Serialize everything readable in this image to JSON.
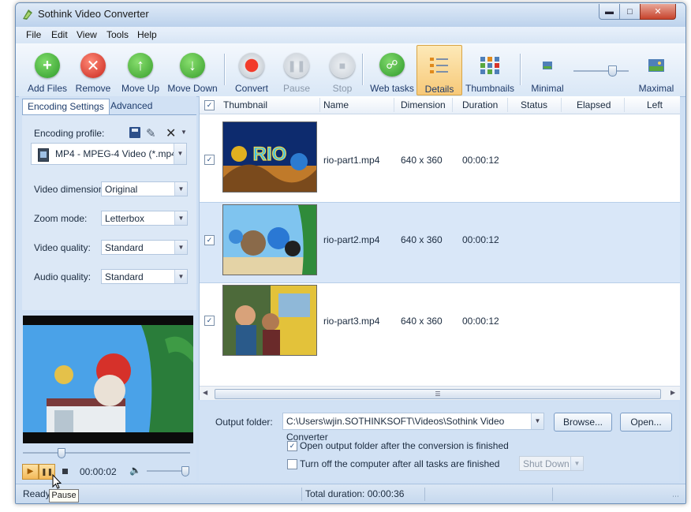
{
  "window": {
    "title": "Sothink Video Converter"
  },
  "menu": [
    "File",
    "Edit",
    "View",
    "Tools",
    "Help"
  ],
  "toolbar": {
    "add": "Add Files",
    "remove": "Remove",
    "move_up": "Move Up",
    "move_down": "Move Down",
    "convert": "Convert",
    "pause": "Pause",
    "stop": "Stop",
    "web": "Web tasks",
    "details": "Details",
    "thumbnails": "Thumbnails",
    "minimal": "Minimal",
    "maximal": "Maximal"
  },
  "tabs": {
    "encoding": "Encoding Settings",
    "advanced": "Advanced"
  },
  "encoding": {
    "profile_label": "Encoding profile:",
    "profile_value": "MP4 - MPEG-4 Video (*.mp4)",
    "dimension_label": "Video dimension:",
    "dimension_value": "Original",
    "zoom_label": "Zoom mode:",
    "zoom_value": "Letterbox",
    "quality_label": "Video quality:",
    "quality_value": "Standard",
    "audio_label": "Audio quality:",
    "audio_value": "Standard"
  },
  "player": {
    "time": "00:00:02",
    "tooltip": "Pause"
  },
  "columns": [
    "Thumbnail",
    "Name",
    "Dimension",
    "Duration",
    "Status",
    "Elapsed",
    "Left"
  ],
  "rows": [
    {
      "name": "rio-part1.mp4",
      "dimension": "640 x 360",
      "duration": "00:00:12",
      "thumb_text": "RIO"
    },
    {
      "name": "rio-part2.mp4",
      "dimension": "640 x 360",
      "duration": "00:00:12"
    },
    {
      "name": "rio-part3.mp4",
      "dimension": "640 x 360",
      "duration": "00:00:12"
    }
  ],
  "output": {
    "label": "Output folder:",
    "path": "C:\\Users\\wjin.SOTHINKSOFT\\Videos\\Sothink Video Converter",
    "browse": "Browse...",
    "open": "Open...",
    "open_after": "Open output folder after the conversion is finished",
    "turn_off": "Turn off the computer after all tasks are finished",
    "shutdown": "Shut Down"
  },
  "status": {
    "left": "Ready",
    "total": "Total duration: 00:00:36"
  },
  "colors": {
    "accent": "#cfe0f4",
    "add": "#3aa93a",
    "remove": "#d8342a",
    "move": "#4aac3c",
    "selected_row": "#d9e7f8"
  }
}
